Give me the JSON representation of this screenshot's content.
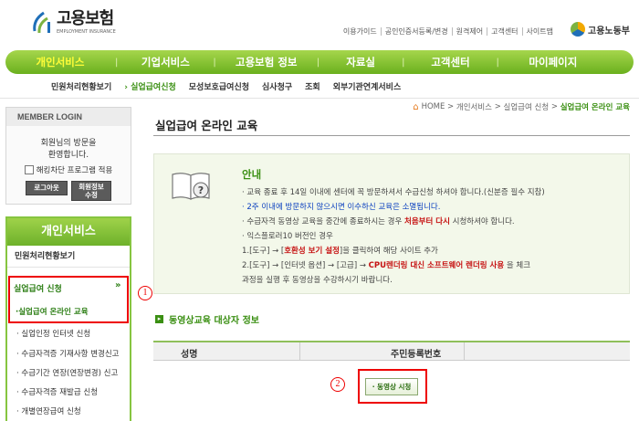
{
  "header": {
    "logo_kor": "고용보험",
    "logo_eng": "EMPLOYMENT INSURANCE",
    "util_links": [
      "이용가이드",
      "공인인증서등록/변경",
      "원격제어",
      "고객센터",
      "사이트맵"
    ],
    "ministry": "고용노동부"
  },
  "main_nav": [
    "개인서비스",
    "기업서비스",
    "고용보험 정보",
    "자료실",
    "고객센터",
    "마이페이지"
  ],
  "sub_nav": [
    "민원처리현황보기",
    "실업급여신청",
    "모성보호급여신청",
    "심사청구",
    "조회",
    "외부기관연계서비스"
  ],
  "login": {
    "title": "MEMBER LOGIN",
    "msg1": "회원님의 방문을",
    "msg2": "환영합니다.",
    "hacking_label": "해킹차단 프로그램 적용",
    "logout": "로그아웃",
    "info1": "회원정보",
    "info2": "수정"
  },
  "left_menu": {
    "title": "개인서비스",
    "item1": "민원처리현황보기",
    "item2": "실업급여 신청",
    "item2_arrow": "»",
    "current": "·실업급여 온라인 교육",
    "subs": [
      "실업인정 인터넷 신청",
      "수급자격증 기재사항 변경신고",
      "수급기간 연장(연장변경) 신고",
      "수급자격증 재발급 신청",
      "개별연장급여 신청"
    ]
  },
  "markers": {
    "m1": "1",
    "m2": "2"
  },
  "breadcrumb": [
    "HOME",
    "개인서비스",
    "실업급여 신청",
    "실업급여 온라인 교육"
  ],
  "page_title": "실업급여 온라인 교육",
  "notice": {
    "title": "안내",
    "l1": "· 교육 종료 후 14일 이내에 센터에 꼭 방문하셔서 수급신청 하셔야 합니다.(신분증 필수 지참)",
    "l2": "· 2주 이내에 방문하지 않으시면 이수하신 교육은 소멸됩니다.",
    "l3a": "· 수급자격 동영상 교육을 중간에 종료하시는 경우 ",
    "l3b": "처음부터 다시",
    "l3c": " 시청하셔야 합니다.",
    "l4": "· 익스플로러10 버전인 경우",
    "l5a": "1.[도구] → [",
    "l5b": "호환성 보기 설정",
    "l5c": "]을 클릭하여 해당 사이트 추가",
    "l6a": "2.[도구] → [인터넷 옵션] → [고급] → ",
    "l6b": "CPU렌더링 대신 소프트웨어 렌더링 사용",
    "l6c": " 을 체크",
    "l7": "과정을 실행 후 동영상을 수강하시기 바랍니다."
  },
  "section_title": "동영상교육 대상자 정보",
  "table": {
    "col1": "성명",
    "col2": "주민등록번호"
  },
  "video_button": "· 동영상 시청"
}
